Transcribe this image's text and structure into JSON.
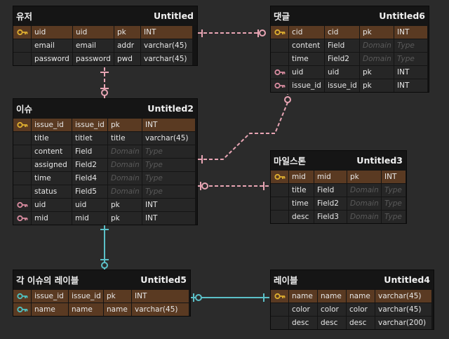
{
  "colors": {
    "relation_pink": "#e8a5b4",
    "relation_cyan": "#5bc0c8",
    "pk_row": "#5a3a22",
    "key_gold": "#e0b030",
    "key_pink": "#d98ca0",
    "key_cyan": "#4fc3c3"
  },
  "tables": [
    {
      "id": "user",
      "name": "유저",
      "sub": "Untitled",
      "rows": [
        {
          "key": "gold",
          "pk": true,
          "cells": [
            "uid",
            "uid",
            "pk",
            "INT"
          ]
        },
        {
          "key": "",
          "pk": false,
          "cells": [
            "email",
            "email",
            "addr",
            "varchar(45)"
          ]
        },
        {
          "key": "",
          "pk": false,
          "cells": [
            "password",
            "password",
            "pwd",
            "varchar(45)"
          ]
        }
      ]
    },
    {
      "id": "comment",
      "name": "댓글",
      "sub": "Untitled6",
      "rows": [
        {
          "key": "gold",
          "pk": true,
          "cells": [
            "cid",
            "cid",
            "pk",
            "INT"
          ]
        },
        {
          "key": "",
          "pk": false,
          "cells": [
            "content",
            "Field",
            "Domain",
            "Type"
          ],
          "ph": [
            2,
            3
          ]
        },
        {
          "key": "",
          "pk": false,
          "cells": [
            "time",
            "Field2",
            "Domain",
            "Type"
          ],
          "ph": [
            2,
            3
          ]
        },
        {
          "key": "pink",
          "pk": false,
          "cells": [
            "uid",
            "uid",
            "pk",
            "INT"
          ]
        },
        {
          "key": "pink",
          "pk": false,
          "cells": [
            "issue_id",
            "issue_id",
            "pk",
            "INT"
          ]
        }
      ]
    },
    {
      "id": "issue",
      "name": "이슈",
      "sub": "Untitled2",
      "rows": [
        {
          "key": "gold",
          "pk": true,
          "cells": [
            "issue_id",
            "issue_id",
            "pk",
            "INT"
          ]
        },
        {
          "key": "",
          "pk": false,
          "cells": [
            "title",
            "titlet",
            "title",
            "varchar(45)"
          ]
        },
        {
          "key": "",
          "pk": false,
          "cells": [
            "content",
            "Field",
            "Domain",
            "Type"
          ],
          "ph": [
            2,
            3
          ]
        },
        {
          "key": "",
          "pk": false,
          "cells": [
            "assigned",
            "Field2",
            "Domain",
            "Type"
          ],
          "ph": [
            2,
            3
          ]
        },
        {
          "key": "",
          "pk": false,
          "cells": [
            "time",
            "Field4",
            "Domain",
            "Type"
          ],
          "ph": [
            2,
            3
          ]
        },
        {
          "key": "",
          "pk": false,
          "cells": [
            "status",
            "Field5",
            "Domain",
            "Type"
          ],
          "ph": [
            2,
            3
          ]
        },
        {
          "key": "pink",
          "pk": false,
          "cells": [
            "uid",
            "uid",
            "pk",
            "INT"
          ]
        },
        {
          "key": "pink",
          "pk": false,
          "cells": [
            "mid",
            "mid",
            "pk",
            "INT"
          ]
        }
      ]
    },
    {
      "id": "milestone",
      "name": "마일스톤",
      "sub": "Untitled3",
      "rows": [
        {
          "key": "gold",
          "pk": true,
          "cells": [
            "mid",
            "mid",
            "pk",
            "INT"
          ]
        },
        {
          "key": "",
          "pk": false,
          "cells": [
            "title",
            "Field",
            "Domain",
            "Type"
          ],
          "ph": [
            2,
            3
          ]
        },
        {
          "key": "",
          "pk": false,
          "cells": [
            "time",
            "Field2",
            "Domain",
            "Type"
          ],
          "ph": [
            2,
            3
          ]
        },
        {
          "key": "",
          "pk": false,
          "cells": [
            "desc",
            "Field3",
            "Domain",
            "Type"
          ],
          "ph": [
            2,
            3
          ]
        }
      ]
    },
    {
      "id": "issue_label",
      "name": "각 이슈의 레이블",
      "sub": "Untitled5",
      "rows": [
        {
          "key": "cyan",
          "pk": true,
          "cells": [
            "issue_id",
            "issue_id",
            "pk",
            "INT"
          ]
        },
        {
          "key": "cyan",
          "pk": true,
          "cells": [
            "name",
            "name",
            "name",
            "varchar(45)"
          ]
        }
      ]
    },
    {
      "id": "label",
      "name": "레이블",
      "sub": "Untitled4",
      "rows": [
        {
          "key": "gold",
          "pk": true,
          "cells": [
            "name",
            "name",
            "name",
            "varchar(45)"
          ]
        },
        {
          "key": "",
          "pk": false,
          "cells": [
            "color",
            "color",
            "color",
            "varchar(45)"
          ]
        },
        {
          "key": "",
          "pk": false,
          "cells": [
            "desc",
            "desc",
            "desc",
            "varchar(200)"
          ]
        }
      ]
    }
  ]
}
